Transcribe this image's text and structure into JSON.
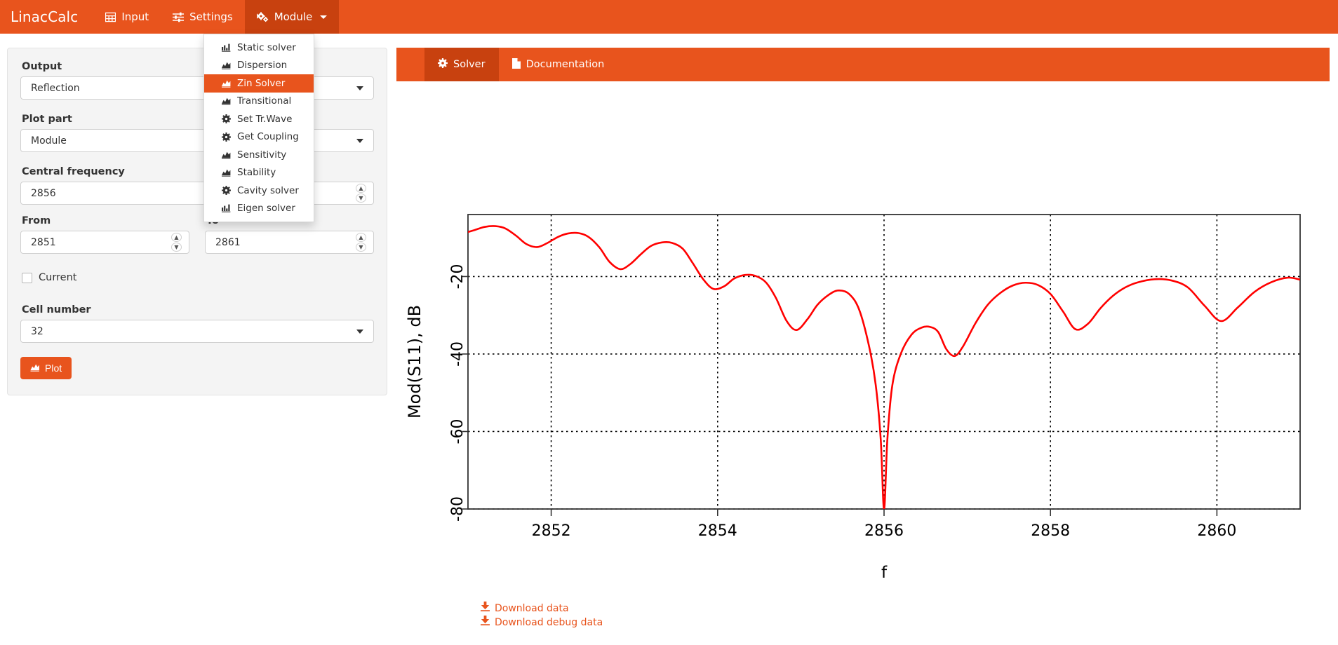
{
  "colors": {
    "brand": "#e8541d",
    "brand_dark": "#c8410f",
    "panel_bg": "#f4f4f4",
    "curve": "#ff0000",
    "link": "#e8541d"
  },
  "navbar": {
    "brand": "LinacCalc",
    "items": [
      {
        "label": "Input",
        "icon": "table-icon",
        "active": false
      },
      {
        "label": "Settings",
        "icon": "sliders-icon",
        "active": false
      },
      {
        "label": "Module",
        "icon": "cogs-icon",
        "active": true,
        "has_caret": true
      }
    ]
  },
  "module_menu": {
    "items": [
      {
        "label": "Static solver",
        "icon": "chart-bar-icon",
        "selected": false
      },
      {
        "label": "Dispersion",
        "icon": "chart-area-icon",
        "selected": false
      },
      {
        "label": "Zin Solver",
        "icon": "chart-area-icon",
        "selected": true
      },
      {
        "label": "Transitional",
        "icon": "chart-area-icon",
        "selected": false
      },
      {
        "label": "Set Tr.Wave",
        "icon": "gear-icon",
        "selected": false
      },
      {
        "label": "Get Coupling",
        "icon": "gear-icon",
        "selected": false
      },
      {
        "label": "Sensitivity",
        "icon": "chart-area-icon",
        "selected": false
      },
      {
        "label": "Stability",
        "icon": "chart-area-icon",
        "selected": false
      },
      {
        "label": "Cavity solver",
        "icon": "gear-icon",
        "selected": false
      },
      {
        "label": "Eigen solver",
        "icon": "chart-bar-icon",
        "selected": false
      }
    ]
  },
  "form": {
    "output": {
      "label": "Output",
      "value": "Reflection",
      "options": [
        "Reflection"
      ]
    },
    "plot_part": {
      "label": "Plot part",
      "value": "Module",
      "options": [
        "Module"
      ]
    },
    "central_frequency": {
      "label": "Central frequency",
      "value": "2856"
    },
    "from": {
      "label": "From",
      "value": "2851"
    },
    "to": {
      "label": "To",
      "value": "2861"
    },
    "current": {
      "label": "Current",
      "checked": false
    },
    "cell_number": {
      "label": "Cell number",
      "value": "32",
      "options": [
        "32"
      ]
    },
    "plot_button": {
      "label": "Plot",
      "icon": "chart-area-icon"
    }
  },
  "tabs": [
    {
      "label": "Solver",
      "icon": "gear-icon",
      "active": true
    },
    {
      "label": "Documentation",
      "icon": "file-icon",
      "active": false
    }
  ],
  "downloads": [
    {
      "label": "Download data",
      "icon": "download-icon"
    },
    {
      "label": "Download debug data",
      "icon": "download-icon"
    }
  ],
  "chart_data": {
    "type": "line",
    "title": "",
    "xlabel": "f",
    "ylabel": "Mod(S11), dB",
    "xlim": [
      2851,
      2861
    ],
    "ylim": [
      -80,
      -4
    ],
    "xticks": [
      2852,
      2854,
      2856,
      2858,
      2860
    ],
    "yticks": [
      -20,
      -40,
      -60,
      -80
    ],
    "grid": true,
    "legend": false,
    "series": [
      {
        "name": "Mod(S11)",
        "color": "#ff0000",
        "x": [
          2851.0,
          2851.08,
          2851.2,
          2851.33,
          2851.45,
          2851.58,
          2851.7,
          2851.83,
          2851.95,
          2852.08,
          2852.2,
          2852.33,
          2852.45,
          2852.58,
          2852.7,
          2852.83,
          2852.95,
          2853.08,
          2853.2,
          2853.33,
          2853.45,
          2853.58,
          2853.7,
          2853.83,
          2853.95,
          2854.08,
          2854.2,
          2854.33,
          2854.45,
          2854.58,
          2854.7,
          2854.83,
          2854.95,
          2855.08,
          2855.2,
          2855.33,
          2855.45,
          2855.58,
          2855.7,
          2855.82,
          2855.9,
          2855.96,
          2856.0,
          2856.04,
          2856.1,
          2856.2,
          2856.33,
          2856.45,
          2856.55,
          2856.65,
          2856.75,
          2856.85,
          2856.95,
          2857.1,
          2857.25,
          2857.4,
          2857.55,
          2857.7,
          2857.85,
          2858.0,
          2858.15,
          2858.3,
          2858.45,
          2858.6,
          2858.75,
          2858.9,
          2859.05,
          2859.25,
          2859.45,
          2859.65,
          2859.85,
          2860.05,
          2860.25,
          2860.45,
          2860.65,
          2860.85,
          2861.0
        ],
        "y": [
          -8.5,
          -8.0,
          -7.2,
          -7.0,
          -7.6,
          -9.5,
          -11.6,
          -12.4,
          -11.4,
          -9.8,
          -8.9,
          -8.8,
          -9.8,
          -12.5,
          -16.2,
          -18.1,
          -16.8,
          -14.2,
          -12.1,
          -11.2,
          -11.3,
          -12.8,
          -16.5,
          -20.8,
          -23.2,
          -22.5,
          -20.5,
          -19.6,
          -19.8,
          -21.5,
          -25.5,
          -31.5,
          -33.8,
          -31.0,
          -27.3,
          -24.8,
          -23.6,
          -24.5,
          -28.5,
          -38.0,
          -48.0,
          -62.0,
          -80.0,
          -62.0,
          -48.0,
          -40.0,
          -35.0,
          -33.2,
          -33.0,
          -34.3,
          -38.8,
          -40.5,
          -38.0,
          -32.0,
          -27.2,
          -24.2,
          -22.3,
          -21.6,
          -22.2,
          -24.5,
          -29.0,
          -33.6,
          -32.2,
          -28.2,
          -25.0,
          -22.8,
          -21.5,
          -20.7,
          -21.0,
          -22.8,
          -27.5,
          -31.5,
          -28.0,
          -24.0,
          -21.5,
          -20.3,
          -20.8
        ]
      }
    ]
  }
}
